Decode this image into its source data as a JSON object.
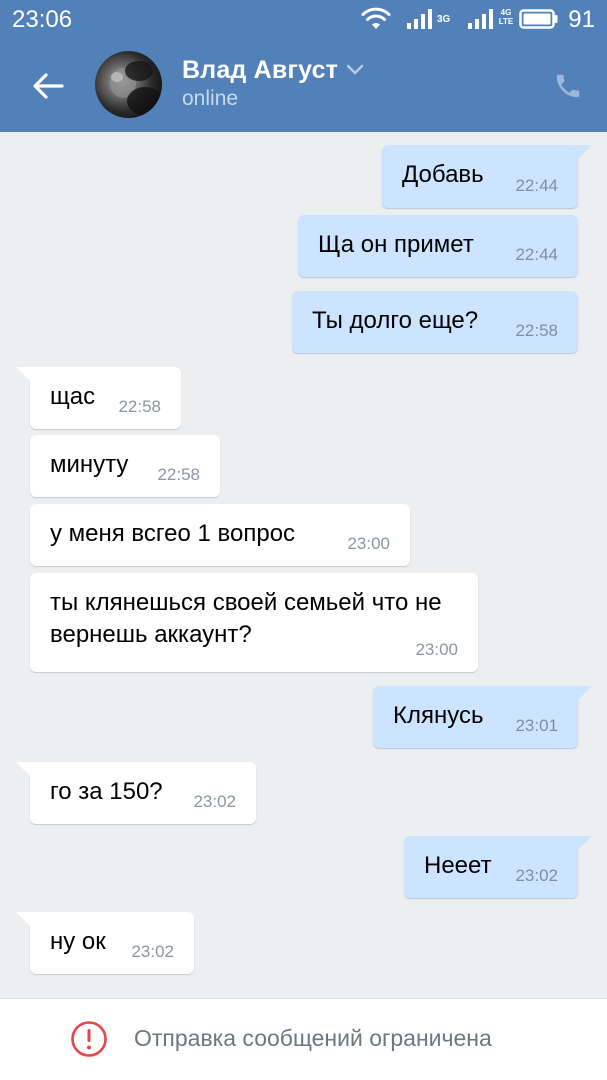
{
  "status_bar": {
    "time": "23:06",
    "network_1": "3G",
    "network_2": "4G LTE",
    "battery_level": "91",
    "icons": [
      "wifi-icon",
      "signal-icon",
      "signal-icon",
      "battery-icon"
    ]
  },
  "header": {
    "contact_name": "Влад Август",
    "contact_status": "online",
    "icons": [
      "back-arrow-icon",
      "chevron-down-icon",
      "phone-icon"
    ]
  },
  "colors": {
    "header_bg": "#5181b8",
    "outgoing_bubble": "#cce4ff",
    "incoming_bubble": "#ffffff",
    "chat_bg": "#edeef0",
    "warning_red": "#e64646"
  },
  "messages": [
    {
      "direction": "out",
      "text": "Добавь",
      "time": "22:44"
    },
    {
      "direction": "out",
      "text": "Ща он примет",
      "time": "22:44"
    },
    {
      "direction": "out",
      "text": "Ты долго еще?",
      "time": "22:58"
    },
    {
      "direction": "in",
      "text": "щас",
      "time": "22:58"
    },
    {
      "direction": "in",
      "text": "минуту",
      "time": "22:58"
    },
    {
      "direction": "in",
      "text": "у меня всгео 1 вопрос",
      "time": "23:00"
    },
    {
      "direction": "in",
      "text": "ты клянешься своей семьей что не вернешь аккаунт?",
      "time": "23:00"
    },
    {
      "direction": "out",
      "text": "Клянусь",
      "time": "23:01"
    },
    {
      "direction": "in",
      "text": "го за 150?",
      "time": "23:02"
    },
    {
      "direction": "out",
      "text": "Нееет",
      "time": "23:02"
    },
    {
      "direction": "in",
      "text": "ну ок",
      "time": "23:02"
    }
  ],
  "footer": {
    "restriction_text": "Отправка сообщений ограничена",
    "icon": "exclamation-circle-icon"
  }
}
